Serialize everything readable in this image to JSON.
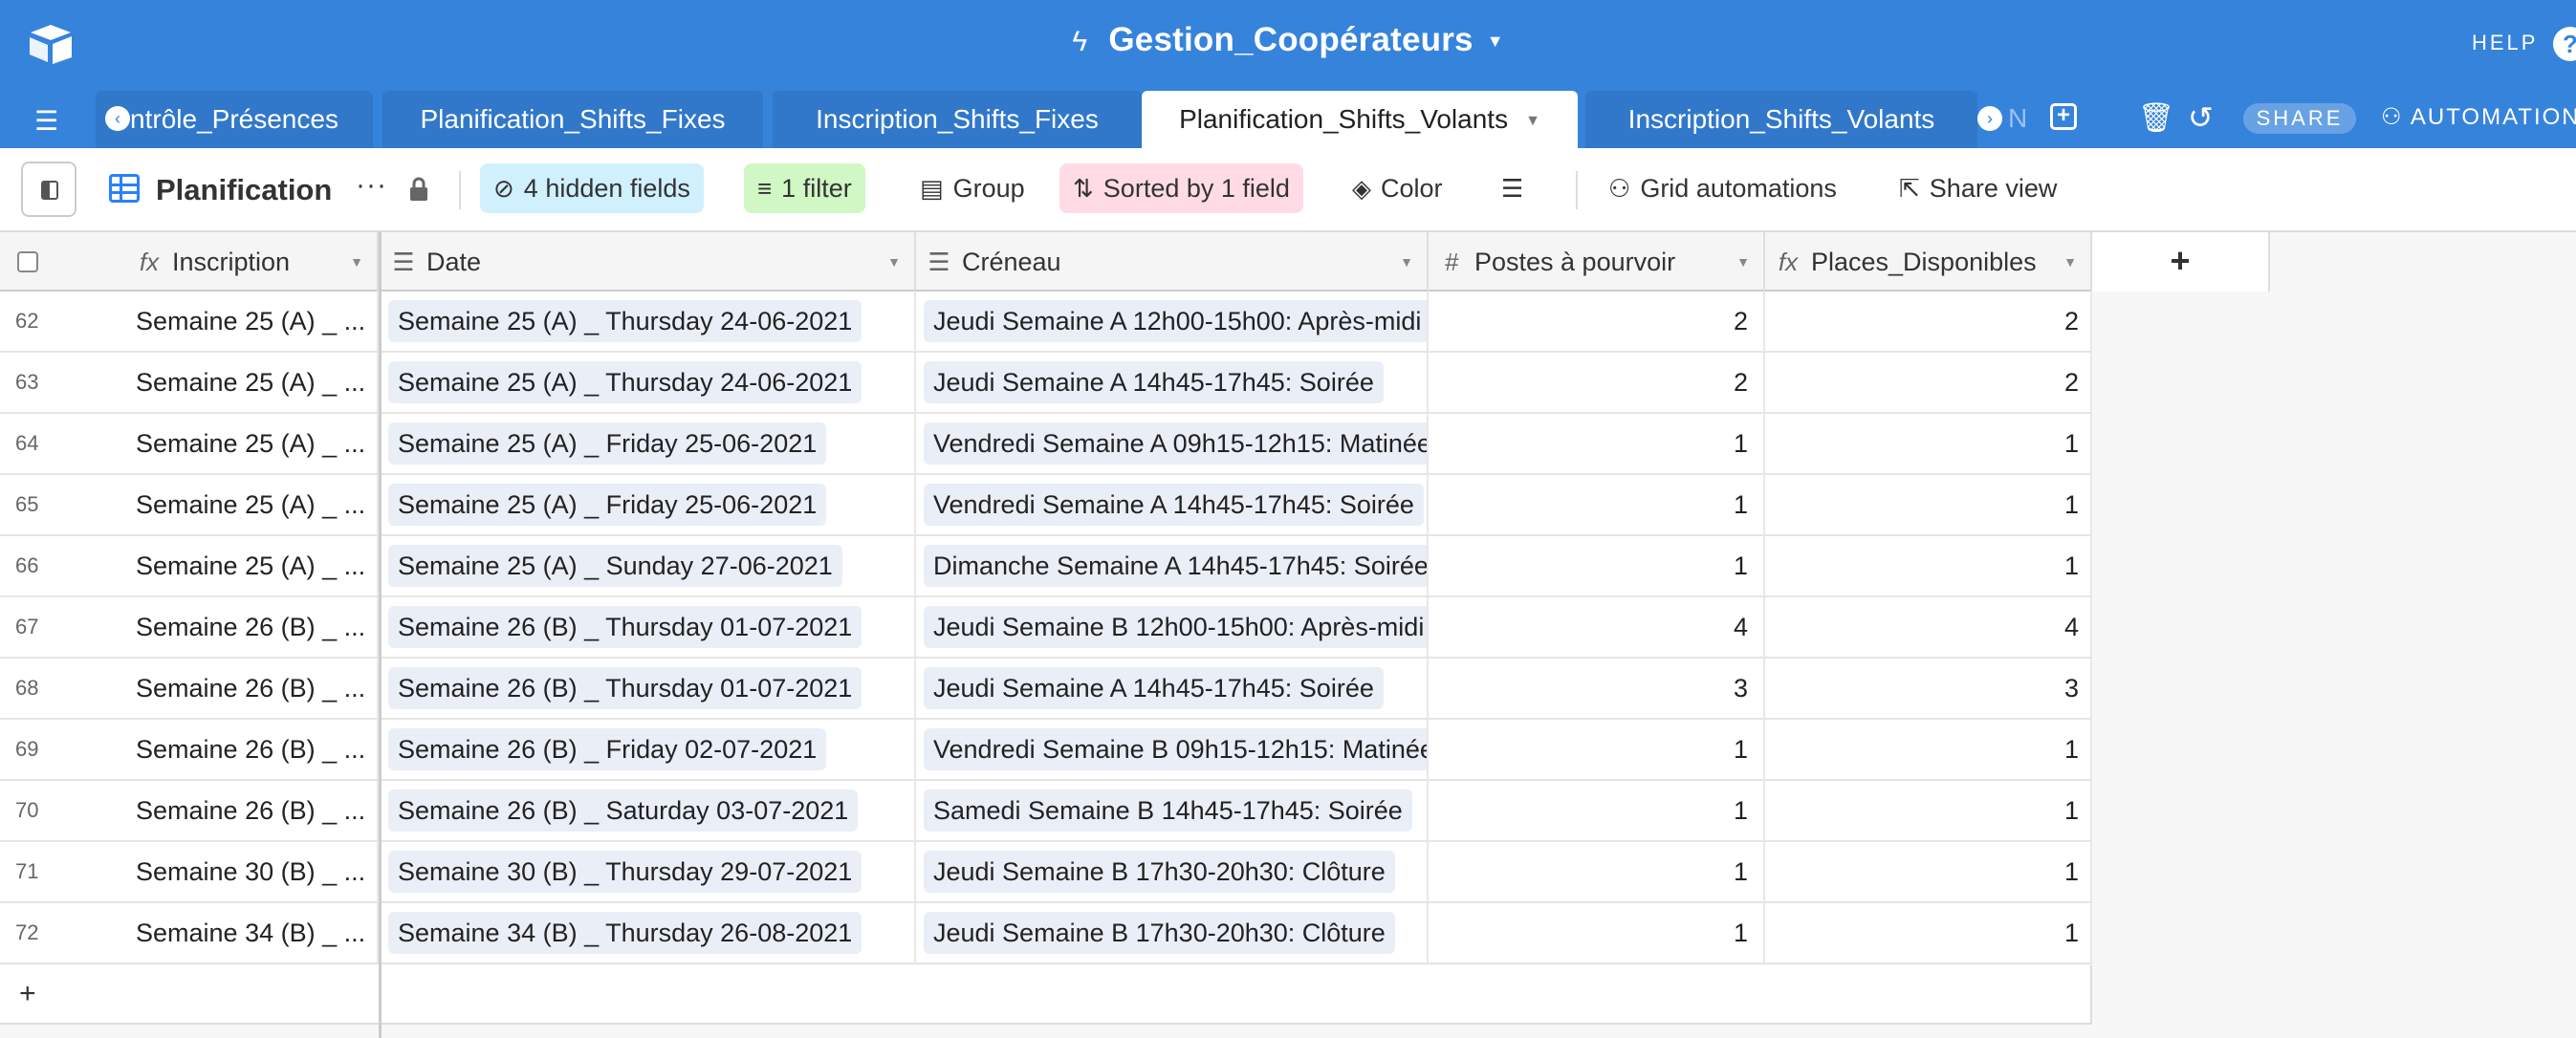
{
  "app": {
    "base_title": "Gestion_Coopérateurs",
    "help_label": "HELP",
    "help_icon": "?",
    "share_label": "SHARE",
    "automations_label": "AUTOMATION"
  },
  "tabs": [
    {
      "label": "ntrôle_Présences",
      "active": false
    },
    {
      "label": "Planification_Shifts_Fixes",
      "active": false
    },
    {
      "label": "Inscription_Shifts_Fixes",
      "active": false
    },
    {
      "label": "Planification_Shifts_Volants",
      "active": true
    },
    {
      "label": "Inscription_Shifts_Volants",
      "active": false
    }
  ],
  "tab_overflow_label": "N",
  "toolbar": {
    "view_name": "Planification",
    "hidden_fields": "4 hidden fields",
    "filter": "1 filter",
    "group": "Group",
    "sort": "Sorted by 1 field",
    "color": "Color",
    "automations": "Grid automations",
    "share_view": "Share view"
  },
  "columns": {
    "inscription": "Inscription",
    "date": "Date",
    "creneau": "Créneau",
    "postes": "Postes à pourvoir",
    "places": "Places_Disponibles"
  },
  "rows": [
    {
      "n": "62",
      "ins": "Semaine 25 (A) _ ...",
      "date": "Semaine 25 (A) _ Thursday 24-06-2021",
      "cren": "Jeudi Semaine A 12h00-15h00: Après-midi",
      "postes": "2",
      "places": "2"
    },
    {
      "n": "63",
      "ins": "Semaine 25 (A) _ ...",
      "date": "Semaine 25 (A) _ Thursday 24-06-2021",
      "cren": "Jeudi Semaine A 14h45-17h45: Soirée",
      "postes": "2",
      "places": "2"
    },
    {
      "n": "64",
      "ins": "Semaine 25 (A) _ ...",
      "date": "Semaine 25 (A) _ Friday 25-06-2021",
      "cren": "Vendredi Semaine A 09h15-12h15: Matinée",
      "postes": "1",
      "places": "1"
    },
    {
      "n": "65",
      "ins": "Semaine 25 (A) _ ...",
      "date": "Semaine 25 (A) _ Friday 25-06-2021",
      "cren": "Vendredi Semaine A 14h45-17h45: Soirée",
      "postes": "1",
      "places": "1"
    },
    {
      "n": "66",
      "ins": "Semaine 25 (A) _ ...",
      "date": "Semaine 25 (A) _ Sunday 27-06-2021",
      "cren": "Dimanche Semaine A 14h45-17h45: Soirée",
      "postes": "1",
      "places": "1"
    },
    {
      "n": "67",
      "ins": "Semaine 26 (B) _ ...",
      "date": "Semaine 26 (B) _ Thursday 01-07-2021",
      "cren": "Jeudi Semaine B 12h00-15h00: Après-midi",
      "postes": "4",
      "places": "4"
    },
    {
      "n": "68",
      "ins": "Semaine 26 (B) _ ...",
      "date": "Semaine 26 (B) _ Thursday 01-07-2021",
      "cren": "Jeudi Semaine A 14h45-17h45: Soirée",
      "postes": "3",
      "places": "3"
    },
    {
      "n": "69",
      "ins": "Semaine 26 (B) _ ...",
      "date": "Semaine 26 (B) _ Friday 02-07-2021",
      "cren": "Vendredi Semaine B 09h15-12h15: Matinée",
      "postes": "1",
      "places": "1"
    },
    {
      "n": "70",
      "ins": "Semaine 26 (B) _ ...",
      "date": "Semaine 26 (B) _ Saturday 03-07-2021",
      "cren": "Samedi Semaine B 14h45-17h45: Soirée",
      "postes": "1",
      "places": "1"
    },
    {
      "n": "71",
      "ins": "Semaine 30 (B) _ ...",
      "date": "Semaine 30 (B) _ Thursday 29-07-2021",
      "cren": "Jeudi Semaine B 17h30-20h30: Clôture",
      "postes": "1",
      "places": "1"
    },
    {
      "n": "72",
      "ins": "Semaine 34 (B) _ ...",
      "date": "Semaine 34 (B) _ Thursday 26-08-2021",
      "cren": "Jeudi Semaine B 17h30-20h30: Clôture",
      "postes": "1",
      "places": "1"
    }
  ],
  "add_row_label": "+",
  "add_column_label": "+",
  "colors": {
    "header_blue": "#3683dc",
    "hidden_fields_bg": "#d0f0fd",
    "filter_bg": "#d1f7c4",
    "sort_bg": "#ffdce5",
    "chip_bg": "#e9eef7"
  },
  "icons": {
    "logo": "airtable-logo-icon",
    "menu": "hamburger-icon",
    "trash": "trash-icon",
    "history": "history-icon",
    "automation": "automation-icon",
    "formula": "formula-icon",
    "text": "long-text-icon",
    "number": "number-icon"
  }
}
